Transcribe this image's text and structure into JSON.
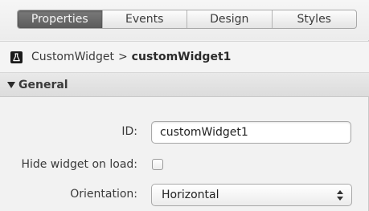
{
  "tabs": [
    {
      "label": "Properties",
      "active": true
    },
    {
      "label": "Events",
      "active": false
    },
    {
      "label": "Design",
      "active": false
    },
    {
      "label": "Styles",
      "active": false
    }
  ],
  "breadcrumb": {
    "icon": "flask-icon",
    "parent": "CustomWidget",
    "separator": ">",
    "current": "customWidget1"
  },
  "section": {
    "title": "General",
    "expanded": true
  },
  "form": {
    "id_label": "ID:",
    "id_value": "customWidget1",
    "hide_label": "Hide widget on load:",
    "hide_checked": false,
    "orientation_label": "Orientation:",
    "orientation_value": "Horizontal"
  },
  "colors": {
    "active_tab": "#666666",
    "panel_bg": "#f2f2f2"
  }
}
